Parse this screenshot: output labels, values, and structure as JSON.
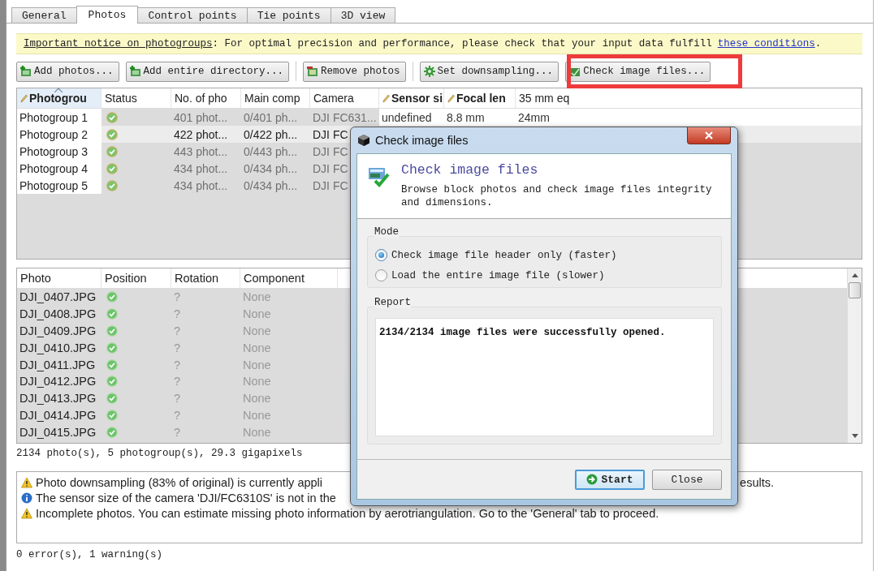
{
  "tabs": [
    {
      "label": "General",
      "selected": false
    },
    {
      "label": "Photos",
      "selected": true
    },
    {
      "label": "Control points",
      "selected": false
    },
    {
      "label": "Tie points",
      "selected": false
    },
    {
      "label": "3D view",
      "selected": false
    }
  ],
  "notice": {
    "link": "Important notice on photogroups",
    "text": ": For optimal precision and performance, please check that your input data fulfill",
    "link2": "these conditions",
    "end": "."
  },
  "toolbar": [
    {
      "label": "Add photos...",
      "kind": "add"
    },
    {
      "label": "Add entire directory...",
      "kind": "add"
    },
    {
      "label": "Remove photos",
      "kind": "remove"
    },
    {
      "label": "Set downsampling...",
      "kind": "gear"
    },
    {
      "label": "Check image files...",
      "kind": "check"
    }
  ],
  "groups_table": {
    "columns": [
      {
        "label": "Photogrou",
        "editable": true,
        "sorted": true
      },
      {
        "label": "Status",
        "editable": false,
        "sorted": false
      },
      {
        "label": "No. of pho",
        "editable": false,
        "sorted": false
      },
      {
        "label": "Main comp",
        "editable": false,
        "sorted": false
      },
      {
        "label": "Camera",
        "editable": false,
        "sorted": false
      },
      {
        "label": "Sensor si",
        "editable": true,
        "sorted": false
      },
      {
        "label": "Focal len",
        "editable": true,
        "sorted": false
      },
      {
        "label": "35 mm eq",
        "editable": false,
        "sorted": false
      }
    ],
    "rows": [
      {
        "selected": false,
        "cells": [
          "Photogroup 1",
          "",
          "401 phot...",
          "0/401 ph...",
          "DJI FC631...",
          "undefined",
          "8.8 mm",
          "24mm"
        ]
      },
      {
        "selected": true,
        "cells": [
          "Photogroup 2",
          "",
          "422 phot...",
          "0/422 ph...",
          "DJI FC"
        ]
      },
      {
        "selected": false,
        "cells": [
          "Photogroup 3",
          "",
          "443 phot...",
          "0/443 ph...",
          "DJI FC"
        ]
      },
      {
        "selected": false,
        "cells": [
          "Photogroup 4",
          "",
          "434 phot...",
          "0/434 ph...",
          "DJI FC"
        ]
      },
      {
        "selected": false,
        "cells": [
          "Photogroup 5",
          "",
          "434 phot...",
          "0/434 ph...",
          "DJI FC"
        ]
      }
    ]
  },
  "photos_table": {
    "columns": [
      "Photo",
      "Position",
      "Rotation",
      "Component"
    ],
    "rows": [
      {
        "photo": "DJI_0407.JPG",
        "rotation": "?",
        "component": "None"
      },
      {
        "photo": "DJI_0408.JPG",
        "rotation": "?",
        "component": "None"
      },
      {
        "photo": "DJI_0409.JPG",
        "rotation": "?",
        "component": "None"
      },
      {
        "photo": "DJI_0410.JPG",
        "rotation": "?",
        "component": "None"
      },
      {
        "photo": "DJI_0411.JPG",
        "rotation": "?",
        "component": "None"
      },
      {
        "photo": "DJI_0412.JPG",
        "rotation": "?",
        "component": "None"
      },
      {
        "photo": "DJI_0413.JPG",
        "rotation": "?",
        "component": "None"
      },
      {
        "photo": "DJI_0414.JPG",
        "rotation": "?",
        "component": "None"
      },
      {
        "photo": "DJI_0415.JPG",
        "rotation": "?",
        "component": "None"
      }
    ]
  },
  "summary": "2134 photo(s), 5 photogroup(s), 29.3 gigapixels",
  "messages": [
    {
      "kind": "warning",
      "text": "Photo downsampling (83% of original) is currently appli",
      "tail": "esults."
    },
    {
      "kind": "info",
      "text": "The sensor size of the camera 'DJI/FC6310S' is not in the"
    },
    {
      "kind": "warning",
      "text": "Incomplete photos. You can estimate missing photo information by aerotriangulation. Go to the 'General' tab to proceed."
    }
  ],
  "status_line": "0 error(s), 1 warning(s)",
  "dialog": {
    "title": "Check image files",
    "heading": "Check image files",
    "description": "Browse block photos and check image files integrity and dimensions.",
    "mode_label": "Mode",
    "options": [
      {
        "label": "Check image file header only (faster)",
        "selected": true
      },
      {
        "label": "Load the entire image file (slower)",
        "selected": false
      }
    ],
    "report_label": "Report",
    "report": "2134/2134 image files were successfully opened.",
    "buttons": [
      {
        "label": "Start",
        "default": true
      },
      {
        "label": "Close",
        "default": false
      }
    ]
  }
}
